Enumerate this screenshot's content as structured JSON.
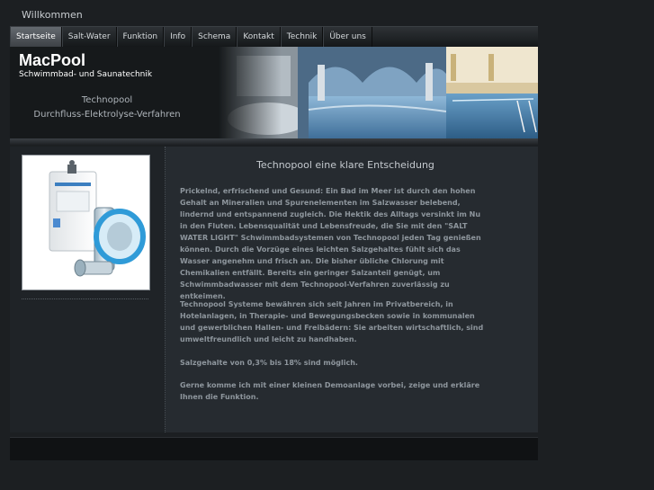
{
  "site": {
    "welcome": "Willkommen",
    "brand": "MacPool",
    "tagline": "Schwimmbad- und Saunatechnik",
    "subtitle_line1": "Technopool",
    "subtitle_line2": "Durchfluss-Elektrolyse-Verfahren"
  },
  "nav": {
    "items": [
      {
        "label": "Startseite",
        "active": true
      },
      {
        "label": "Salt-Water",
        "active": false
      },
      {
        "label": "Funktion",
        "active": false
      },
      {
        "label": "Info",
        "active": false
      },
      {
        "label": "Schema",
        "active": false
      },
      {
        "label": "Kontakt",
        "active": false
      },
      {
        "label": "Technik",
        "active": false
      },
      {
        "label": "Über uns",
        "active": false
      }
    ]
  },
  "main": {
    "title": "Technopool eine klare Entscheidung",
    "paragraphs": [
      "Prickelnd, erfrischend und Gesund: Ein Bad im Meer ist durch den hohen Gehalt an Mineralien und Spurenelementen im Salzwasser belebend, lindernd und entspannend zugleich. Die Hektik des Alltags versinkt im Nu in den Fluten. Lebensqualität und Lebensfreude, die Sie mit den \"SALT WATER LIGHT\" Schwimmbadsystemen von Technopool jeden Tag genießen können. Durch die Vorzüge eines leichten Salzgehaltes fühlt sich das Wasser angenehm und frisch an. Die bisher übliche Chlorung mit Chemikalien entfällt. Bereits ein geringer Salzanteil genügt, um Schwimmbadwasser mit dem Technopool-Verfahren zuverlässig zu entkeimen.",
      "Technopool Systeme bewähren sich seit Jahren im Privatbereich, in Hotelanlagen, in Therapie- und Bewegungsbecken sowie in kommunalen und gewerblichen Hallen- und Freibädern: Sie arbeiten wirtschaftlich, sind umweltfreundlich und leicht zu handhaben.",
      "Salzgehalte von 0,3% bis 18% sind möglich.",
      "Gerne komme ich mit einer kleinen Demoanlage vorbei,  zeige und erkläre Ihnen die Funktion."
    ]
  },
  "colors": {
    "background": "#1c1f22",
    "nav_active": "#555a60",
    "panel": "#262b30",
    "text_muted": "#8e969d"
  }
}
